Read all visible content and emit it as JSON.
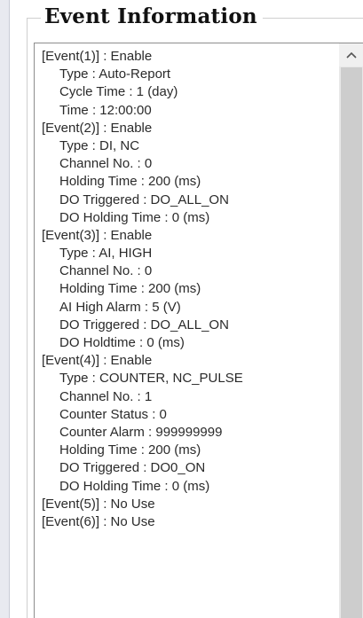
{
  "group": {
    "title": "Event Information"
  },
  "events": [
    {
      "text": "[Event(1)] : Enable",
      "level": 0
    },
    {
      "text": "Type : Auto-Report",
      "level": 1
    },
    {
      "text": "Cycle Time : 1 (day)",
      "level": 1
    },
    {
      "text": "Time : 12:00:00",
      "level": 1
    },
    {
      "text": "[Event(2)] : Enable",
      "level": 0
    },
    {
      "text": "Type : DI, NC",
      "level": 1
    },
    {
      "text": "Channel No. : 0",
      "level": 1
    },
    {
      "text": "Holding Time : 200 (ms)",
      "level": 1
    },
    {
      "text": "DO Triggered : DO_ALL_ON",
      "level": 1
    },
    {
      "text": "DO Holding Time : 0 (ms)",
      "level": 1
    },
    {
      "text": "[Event(3)] : Enable",
      "level": 0
    },
    {
      "text": "Type : AI, HIGH",
      "level": 1
    },
    {
      "text": "Channel No. : 0",
      "level": 1
    },
    {
      "text": "Holding Time : 200 (ms)",
      "level": 1
    },
    {
      "text": "AI High Alarm : 5 (V)",
      "level": 1
    },
    {
      "text": "DO Triggered : DO_ALL_ON",
      "level": 1
    },
    {
      "text": "DO Holdtime : 0 (ms)",
      "level": 1
    },
    {
      "text": "[Event(4)] : Enable",
      "level": 0
    },
    {
      "text": "Type : COUNTER, NC_PULSE",
      "level": 1
    },
    {
      "text": "Channel No. : 1",
      "level": 1
    },
    {
      "text": "Counter Status : 0",
      "level": 1
    },
    {
      "text": "Counter Alarm : 999999999",
      "level": 1
    },
    {
      "text": "Holding Time : 200 (ms)",
      "level": 1
    },
    {
      "text": "DO Triggered : DO0_ON",
      "level": 1
    },
    {
      "text": "DO Holding Time : 0 (ms)",
      "level": 1
    },
    {
      "text": "[Event(5)] : No Use",
      "level": 0
    },
    {
      "text": "[Event(6)] : No Use",
      "level": 0
    }
  ],
  "scrollbar": {
    "up_icon": "chevron-up-icon"
  },
  "colors": {
    "text": "#2a2a2a",
    "scroll_track": "#e8e8e8",
    "scroll_thumb": "#cdcdcd"
  }
}
